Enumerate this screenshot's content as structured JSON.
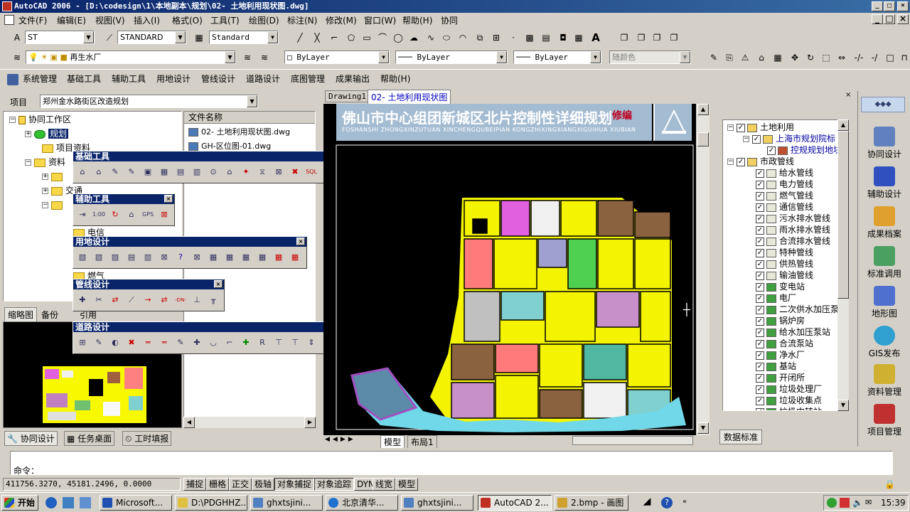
{
  "window": {
    "title": "AutoCAD 2006 - [D:\\codesign\\1\\本地副本\\规划\\02- 土地利用现状图.dwg]"
  },
  "menubar": {
    "items": [
      "文件(F)",
      "编辑(E)",
      "视图(V)",
      "插入(I)",
      "格式(O)",
      "工具(T)",
      "绘图(D)",
      "标注(N)",
      "修改(M)",
      "窗口(W)",
      "帮助(H)",
      "协同"
    ]
  },
  "styles": {
    "text_style": "ST",
    "dim_style": "STANDARD",
    "table_style": "Standard"
  },
  "layers": {
    "current_layer": "再生水厂",
    "color": "ByLayer",
    "linetype": "ByLayer",
    "lineweight": "ByLayer",
    "plot_style": "随颜色"
  },
  "custom_menu": {
    "items": [
      "系统管理",
      "基础工具",
      "辅助工具",
      "用地设计",
      "管线设计",
      "道路设计",
      "底图管理",
      "成果输出",
      "帮助(H)"
    ]
  },
  "project": {
    "label": "项目",
    "value": "郑州金水路街区改造规划"
  },
  "tree": {
    "root": "协同工作区",
    "items": [
      "规划",
      "项目资料",
      "资料",
      "",
      "交通",
      "",
      "电信",
      "",
      "燃气"
    ]
  },
  "file_list": {
    "header": "文件名称",
    "files": [
      "02- 土地利用现状图.dwg",
      "GH-区位图-01.dwg"
    ]
  },
  "left_tabs": {
    "preview": "缩略图",
    "backup": "备份",
    "ref": "引用"
  },
  "bottom_tabs": [
    "协同设计",
    "任务桌面",
    "工时填报"
  ],
  "floating_toolbars": {
    "base": "基础工具",
    "aux": "辅助工具",
    "land": "用地设计",
    "pipe": "管线设计",
    "road": "道路设计"
  },
  "doc_tabs": [
    "Drawing1",
    "02- 土地利用现状图"
  ],
  "drawing": {
    "title": "佛山市中心组团新城区北片控制性详细规划",
    "subtitle": "FOSHANSHI  ZHONGXINZUTUAN  XINCHENGQUBEIPIAN  KONGZHIXINGXIANGXIGUIHUA  XIUBIAN",
    "stamp": "修编"
  },
  "layout_tabs": [
    "模型",
    "布局1"
  ],
  "layer_tree": {
    "groups": [
      "土地利用",
      "上海市规划院标",
      "控规规划地块",
      "市政管线"
    ],
    "items": [
      "给水管线",
      "电力管线",
      "燃气管线",
      "通信管线",
      "污水排水管线",
      "雨水排水管线",
      "合流排水管线",
      "特种管线",
      "供热管线",
      "输油管线",
      "变电站",
      "电厂",
      "二次供水加压泵",
      "锅炉房",
      "给水加压泵站",
      "合流泵站",
      "净水厂",
      "基站",
      "开闭所",
      "垃圾处理厂",
      "垃圾收集点",
      "垃圾中转站"
    ],
    "tab": "数据标准"
  },
  "right_tools": [
    "协同设计",
    "辅助设计",
    "成果档案",
    "标准调用",
    "地形图",
    "GIS发布",
    "资料管理",
    "项目管理"
  ],
  "command": {
    "prompt": "命令："
  },
  "status": {
    "coords": "411756.3270, 45181.2496, 0.0000",
    "buttons": [
      "捕捉",
      "栅格",
      "正交",
      "极轴",
      "对象捕捉",
      "对象追踪",
      "DYN",
      "线宽",
      "模型"
    ]
  },
  "taskbar": {
    "start": "开始",
    "tasks": [
      "Microsoft...",
      "D:\\PDGHHZ...",
      "ghxtsjini...",
      "北京清华...",
      "ghxtsjini...",
      "AutoCAD 2...",
      "2.bmp - 画图"
    ],
    "clock": "15:39"
  },
  "colors": {
    "title_blue": "#0a246a",
    "face": "#d4d0c8",
    "canvas": "#000000"
  }
}
